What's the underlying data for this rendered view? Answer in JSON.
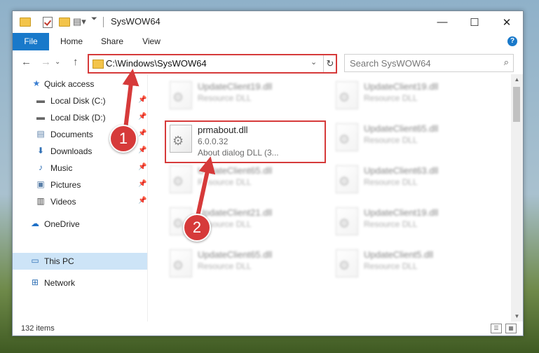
{
  "window": {
    "title": "SysWOW64",
    "minimize": "—",
    "maximize": "☐",
    "close": "✕"
  },
  "ribbon": {
    "tabs": [
      "File",
      "Home",
      "Share",
      "View"
    ],
    "help": "?"
  },
  "address": {
    "path": "C:\\Windows\\SysWOW64",
    "refresh": "↻"
  },
  "search": {
    "placeholder": "Search SysWOW64"
  },
  "nav": {
    "items": [
      {
        "label": "Quick access",
        "icon": "star-icon"
      },
      {
        "label": "Local Disk (C:)",
        "icon": "drive-icon"
      },
      {
        "label": "Local Disk (D:)",
        "icon": "drive-icon"
      },
      {
        "label": "Documents",
        "icon": "documents-icon"
      },
      {
        "label": "Downloads",
        "icon": "download-icon"
      },
      {
        "label": "Music",
        "icon": "music-icon"
      },
      {
        "label": "Pictures",
        "icon": "pictures-icon"
      },
      {
        "label": "Videos",
        "icon": "video-icon"
      },
      {
        "label": "OneDrive",
        "icon": "cloud-icon"
      },
      {
        "label": "This PC",
        "icon": "computer-icon"
      },
      {
        "label": "Network",
        "icon": "network-icon"
      }
    ]
  },
  "files": [
    {
      "name": "UpdateClient19.dll",
      "line2": "Resource DLL",
      "line3": ""
    },
    {
      "name": "UpdateClient19.dll",
      "line2": "Resource DLL",
      "line3": ""
    },
    {
      "name": "prmabout.dll",
      "line2": "6.0.0.32",
      "line3": "About dialog DLL (3..."
    },
    {
      "name": "UpdateClient65.dll",
      "line2": "Resource DLL",
      "line3": ""
    },
    {
      "name": "UpdateClient65.dll",
      "line2": "Resource DLL",
      "line3": ""
    },
    {
      "name": "UpdateClient63.dll",
      "line2": "Resource DLL",
      "line3": ""
    },
    {
      "name": "UpdateClient21.dll",
      "line2": "Resource DLL",
      "line3": ""
    },
    {
      "name": "UpdateClient19.dll",
      "line2": "Resource DLL",
      "line3": ""
    },
    {
      "name": "UpdateClient65.dll",
      "line2": "Resource DLL",
      "line3": ""
    },
    {
      "name": "UpdateClient5.dll",
      "line2": "Resource DLL",
      "line3": ""
    }
  ],
  "status": {
    "count": "132 items"
  },
  "annotations": {
    "step1": "1",
    "step2": "2",
    "color": "#d63a3a"
  }
}
